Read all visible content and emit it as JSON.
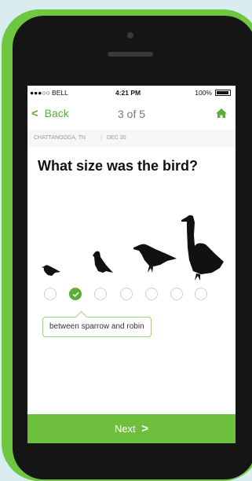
{
  "status_bar": {
    "carrier": "●●●○○ BELL",
    "time": "4:21 PM",
    "battery": "100%"
  },
  "nav": {
    "back_label": "Back",
    "page_counter": "3 of 5",
    "home_icon": "home-icon"
  },
  "meta": {
    "location": "CHATTANOOGA, TN",
    "separator": "|",
    "date": "DEC 30"
  },
  "question": "What size was the bird?",
  "size_options": {
    "count": 7,
    "selected_index": 1,
    "selected_label": "between sparrow and robin"
  },
  "bird_icons": [
    "sparrow-icon",
    "robin-icon",
    "crow-icon",
    "goose-icon"
  ],
  "next_button": {
    "label": "Next"
  },
  "colors": {
    "accent": "#6fbf3f",
    "frame": "#6fc641",
    "tooltip_border": "#9fd085"
  }
}
